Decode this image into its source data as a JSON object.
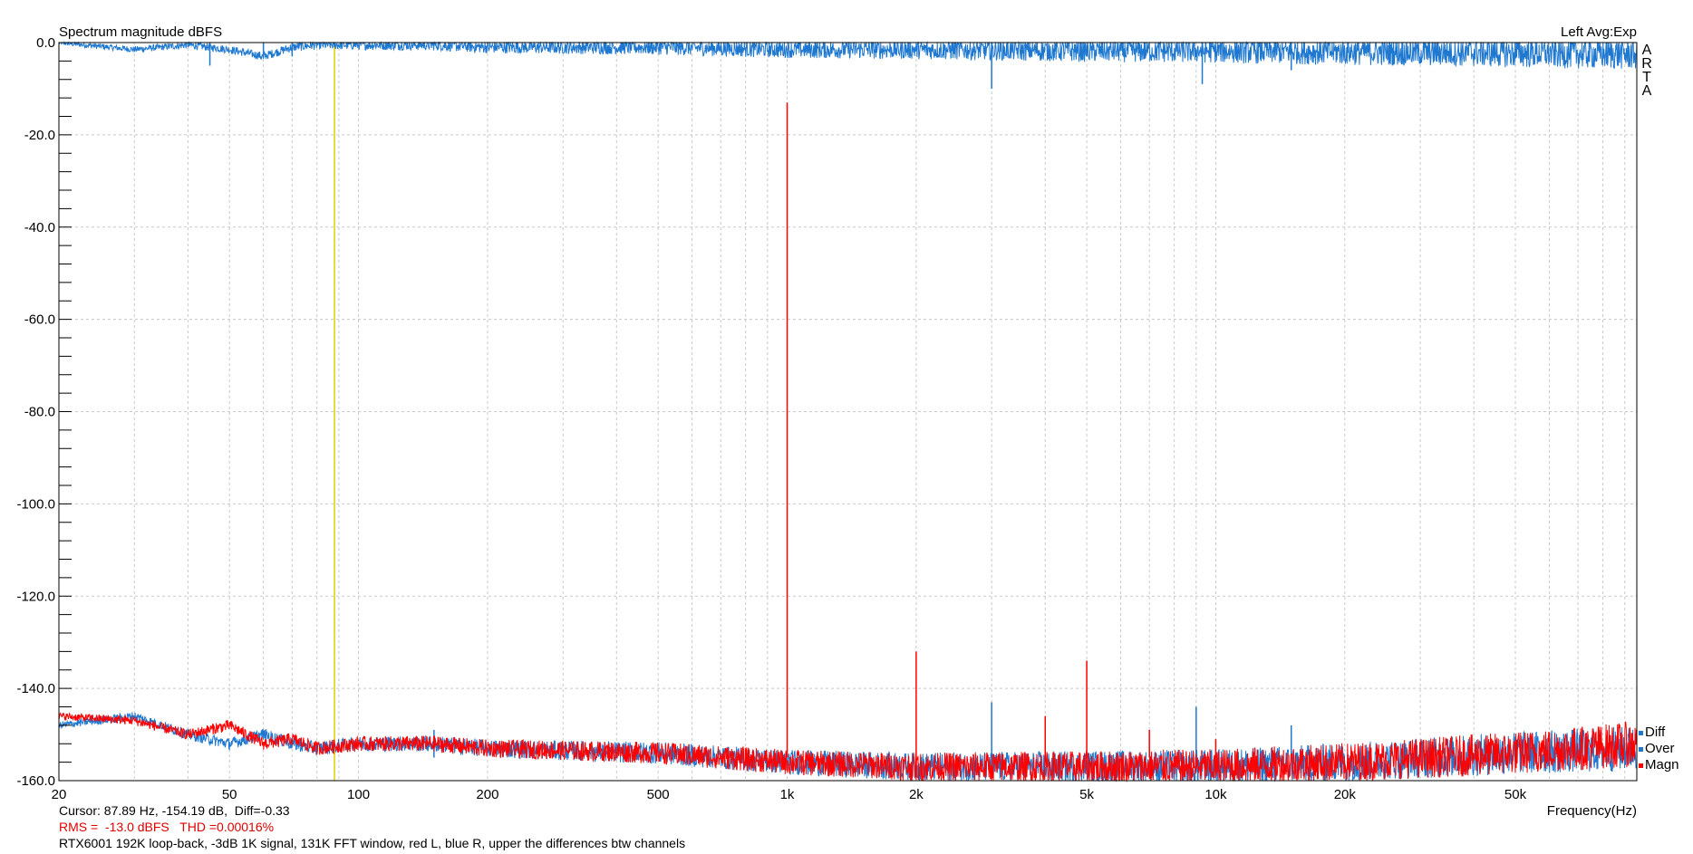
{
  "chart_data": {
    "type": "line",
    "title": "Spectrum magnitude dBFS",
    "top_right": "Left  Avg:Exp",
    "xlabel": "Frequency(Hz)",
    "ylabel": "",
    "x_scale": "log",
    "xlim": [
      20,
      96000
    ],
    "ylim": [
      -160,
      0
    ],
    "grid": true,
    "x_ticks": [
      20,
      50,
      100,
      200,
      500,
      1000,
      2000,
      5000,
      10000,
      20000,
      50000
    ],
    "x_tick_labels": [
      "20",
      "50",
      "100",
      "200",
      "500",
      "1k",
      "2k",
      "5k",
      "10k",
      "20k",
      "50k"
    ],
    "y_ticks": [
      0,
      -20,
      -40,
      -60,
      -80,
      -100,
      -120,
      -140,
      -160
    ],
    "y_tick_labels": [
      "0.0",
      "-20.0",
      "-40.0",
      "-60.0",
      "-80.0",
      "-100.0",
      "-120.0",
      "-140.0",
      "-160.0"
    ],
    "cursor": {
      "freq_hz": 87.89,
      "color": "#e0d000"
    },
    "series": [
      {
        "name": "Diff",
        "color": "#1f78d0",
        "x": [
          20,
          30,
          40,
          50,
          60,
          70,
          80,
          100,
          150,
          200,
          500,
          1000,
          2000,
          5000,
          10000,
          20000,
          50000,
          96000
        ],
        "y": [
          0,
          -1.5,
          -0.5,
          -1.5,
          -3,
          -1,
          -0.5,
          -0.5,
          -0.5,
          -1,
          -1,
          -1.5,
          -1.5,
          -1.8,
          -1.8,
          -2,
          -2.2,
          -2.5
        ],
        "dips": [
          [
            45,
            -5
          ],
          [
            60,
            -3.5
          ],
          [
            70,
            -3
          ],
          [
            3000,
            -10
          ],
          [
            9300,
            -9
          ],
          [
            15000,
            -6
          ]
        ]
      },
      {
        "name": "Over",
        "color": "#1f78d0",
        "x": [
          20,
          30,
          40,
          50,
          60,
          70,
          80,
          100,
          150,
          200,
          500,
          1000,
          2000,
          5000,
          10000,
          20000,
          50000,
          96000
        ],
        "y": [
          -148,
          -146,
          -150,
          -152,
          -150,
          -152,
          -153,
          -152,
          -152,
          -153,
          -154,
          -156,
          -157,
          -157,
          -157,
          -156,
          -154,
          -153
        ],
        "peaks": [
          [
            150,
            -149
          ],
          [
            3000,
            -143
          ],
          [
            9000,
            -144
          ],
          [
            15000,
            -148
          ]
        ]
      },
      {
        "name": "Magn",
        "color": "#ff0000",
        "x": [
          20,
          30,
          40,
          50,
          60,
          70,
          80,
          100,
          150,
          200,
          500,
          1000,
          2000,
          5000,
          10000,
          20000,
          50000,
          96000
        ],
        "y": [
          -146,
          -147,
          -150,
          -148,
          -152,
          -151,
          -153,
          -152,
          -152,
          -153,
          -154,
          -156,
          -157,
          -157,
          -157,
          -156,
          -154,
          -152
        ],
        "peaks": [
          [
            1000,
            -13
          ],
          [
            2000,
            -132
          ],
          [
            4000,
            -146
          ],
          [
            5000,
            -134
          ],
          [
            7000,
            -149
          ],
          [
            10000,
            -151
          ]
        ]
      }
    ]
  },
  "arta": [
    "A",
    "R",
    "T",
    "A"
  ],
  "footer": {
    "cursor": "Cursor: 87.89 Hz, -154.19 dB,  Diff=-0.33",
    "rms": "RMS =  -13.0 dBFS   THD =0.00016%",
    "note": "RTX6001 192K loop-back, -3dB 1K signal, 131K FFT window, red L, blue R, upper the differences btw channels"
  }
}
